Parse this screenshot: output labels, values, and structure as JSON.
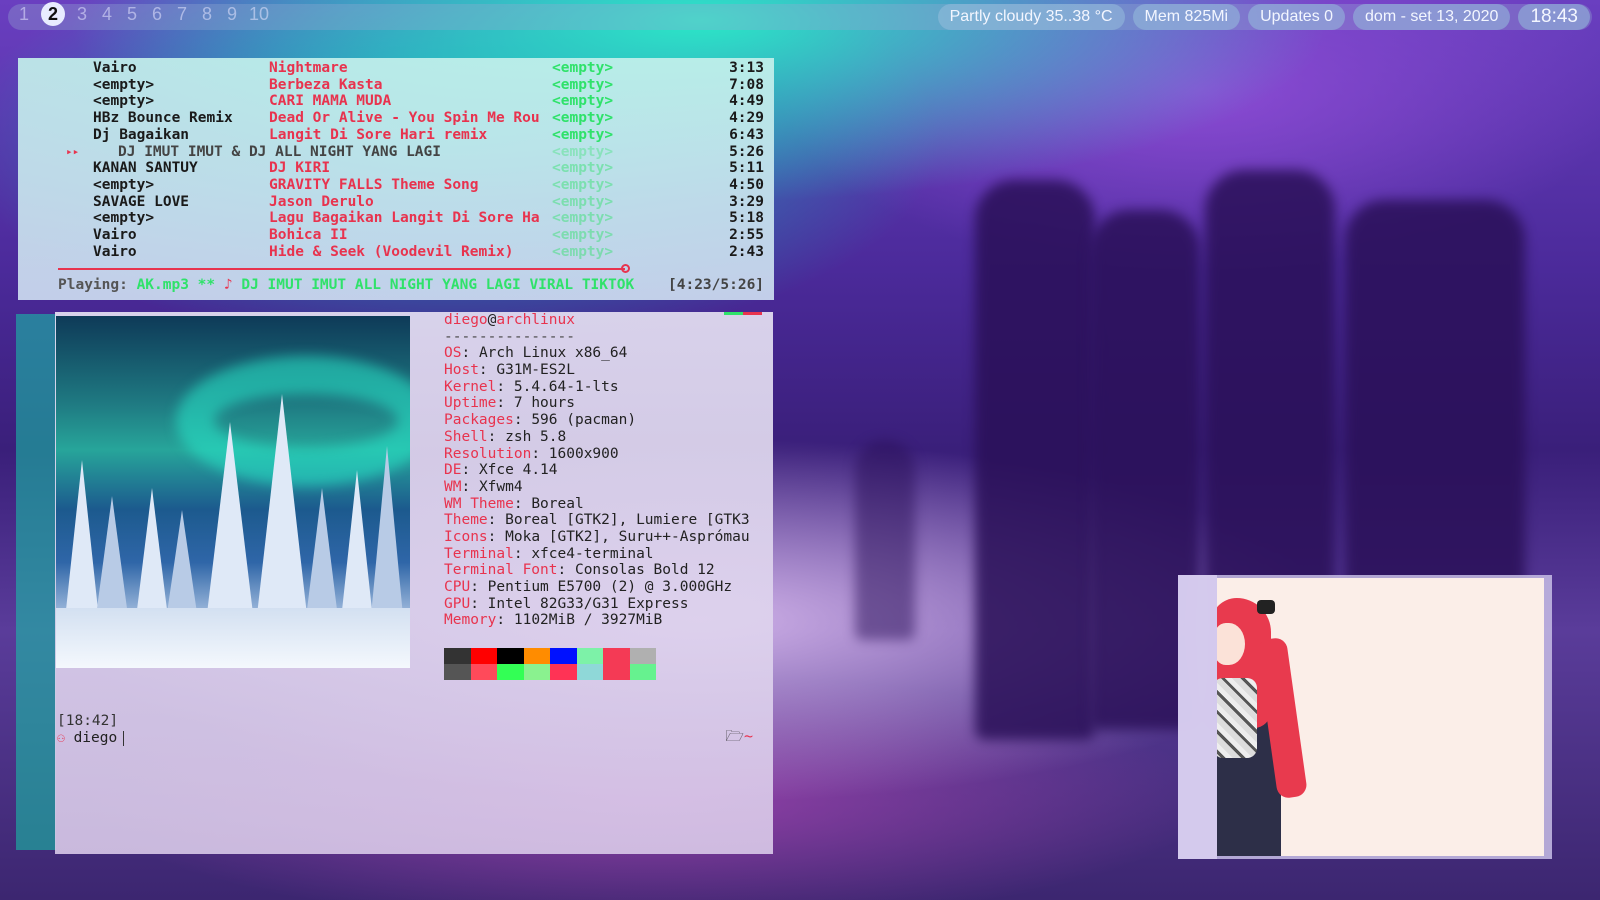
{
  "topbar": {
    "workspaces": [
      "1",
      "2",
      "3",
      "4",
      "5",
      "6",
      "7",
      "8",
      "9",
      "10"
    ],
    "active_workspace": "2",
    "weather": "Partly cloudy 35..38 °C",
    "memory": "Mem 825Mi",
    "updates": "Updates 0",
    "date": "dom - set 13, 2020",
    "clock": "18:43"
  },
  "player": {
    "tracks": [
      {
        "artist": "Vairo",
        "title": "Nightmare",
        "album": "<empty>",
        "time": "3:13"
      },
      {
        "artist": "<empty>",
        "title": "Berbeza Kasta",
        "album": "<empty>",
        "time": "7:08"
      },
      {
        "artist": "<empty>",
        "title": "CARI MAMA MUDA",
        "album": "<empty>",
        "time": "4:49"
      },
      {
        "artist": "HBz Bounce Remix",
        "title": "Dead Or Alive - You Spin Me Rou",
        "album": "<empty>",
        "time": "4:29"
      },
      {
        "artist": "Dj Bagaikan",
        "title": "Langit Di Sore Hari remix",
        "album": "<empty>",
        "time": "6:43"
      },
      {
        "artist": "DJ IMUT IMUT & DJ  ALL NIGHT YANG LAGI",
        "title": "",
        "album": "<empty>",
        "time": "5:26",
        "playing": true
      },
      {
        "artist": "KANAN SANTUY",
        "title": "DJ KIRI",
        "album": "<empty>",
        "time": "5:11"
      },
      {
        "artist": "<empty>",
        "title": "GRAVITY FALLS Theme Song",
        "album": "<empty>",
        "time": "4:50"
      },
      {
        "artist": "SAVAGE LOVE",
        "title": "Jason Derulo",
        "album": "<empty>",
        "time": "3:29"
      },
      {
        "artist": "<empty>",
        "title": "Lagu Bagaikan Langit Di Sore Ha",
        "album": "<empty>",
        "time": "5:18"
      },
      {
        "artist": "Vairo",
        "title": "Bohica II",
        "album": "<empty>",
        "time": "2:55"
      },
      {
        "artist": "Vairo",
        "title": "Hide & Seek (Voodevil Remix)",
        "album": "<empty>",
        "time": "2:43"
      }
    ],
    "status_label": "Playing:",
    "status_file": "AK.mp3 **",
    "status_note": "♪",
    "status_title": "DJ IMUT IMUT ALL NIGHT YANG LAGI VIRAL TIKTOK",
    "elapsed": "[4:23/5:26]",
    "progress": 0.81
  },
  "terminal": {
    "user": "diego",
    "at": "@",
    "host": "archlinux",
    "separator": "---------------",
    "info": [
      {
        "key": "OS",
        "value": "Arch Linux x86_64"
      },
      {
        "key": "Host",
        "value": "G31M-ES2L"
      },
      {
        "key": "Kernel",
        "value": "5.4.64-1-lts"
      },
      {
        "key": "Uptime",
        "value": "7 hours"
      },
      {
        "key": "Packages",
        "value": "596 (pacman)"
      },
      {
        "key": "Shell",
        "value": "zsh 5.8"
      },
      {
        "key": "Resolution",
        "value": "1600x900"
      },
      {
        "key": "DE",
        "value": "Xfce 4.14"
      },
      {
        "key": "WM",
        "value": "Xfwm4"
      },
      {
        "key": "WM Theme",
        "value": "Boreal"
      },
      {
        "key": "Theme",
        "value": "Boreal [GTK2], Lumiere [GTK3"
      },
      {
        "key": "Icons",
        "value": "Moka [GTK2], Suru++-Asprómau"
      },
      {
        "key": "Terminal",
        "value": "xfce4-terminal"
      },
      {
        "key": "Terminal Font",
        "value": "Consolas Bold 12"
      },
      {
        "key": "CPU",
        "value": "Pentium E5700 (2) @ 3.000GHz"
      },
      {
        "key": "GPU",
        "value": "Intel 82G33/G31 Express"
      },
      {
        "key": "Memory",
        "value": "1102MiB / 3927MiB"
      }
    ],
    "palette_colors": [
      "#333333",
      "#ff0000",
      "#000000",
      "#ff8c00",
      "#0011ff",
      "#7df2a8",
      "#f43a55",
      "#b0b0b0",
      "#555555",
      "#ff4a5a",
      "#33ff55",
      "#8af28f",
      "#ff3355",
      "#8fd8d8",
      "#f43a55",
      "#66f28f"
    ],
    "prompt_time": "[18:42]",
    "prompt_user": "diego",
    "cwd": "~"
  }
}
